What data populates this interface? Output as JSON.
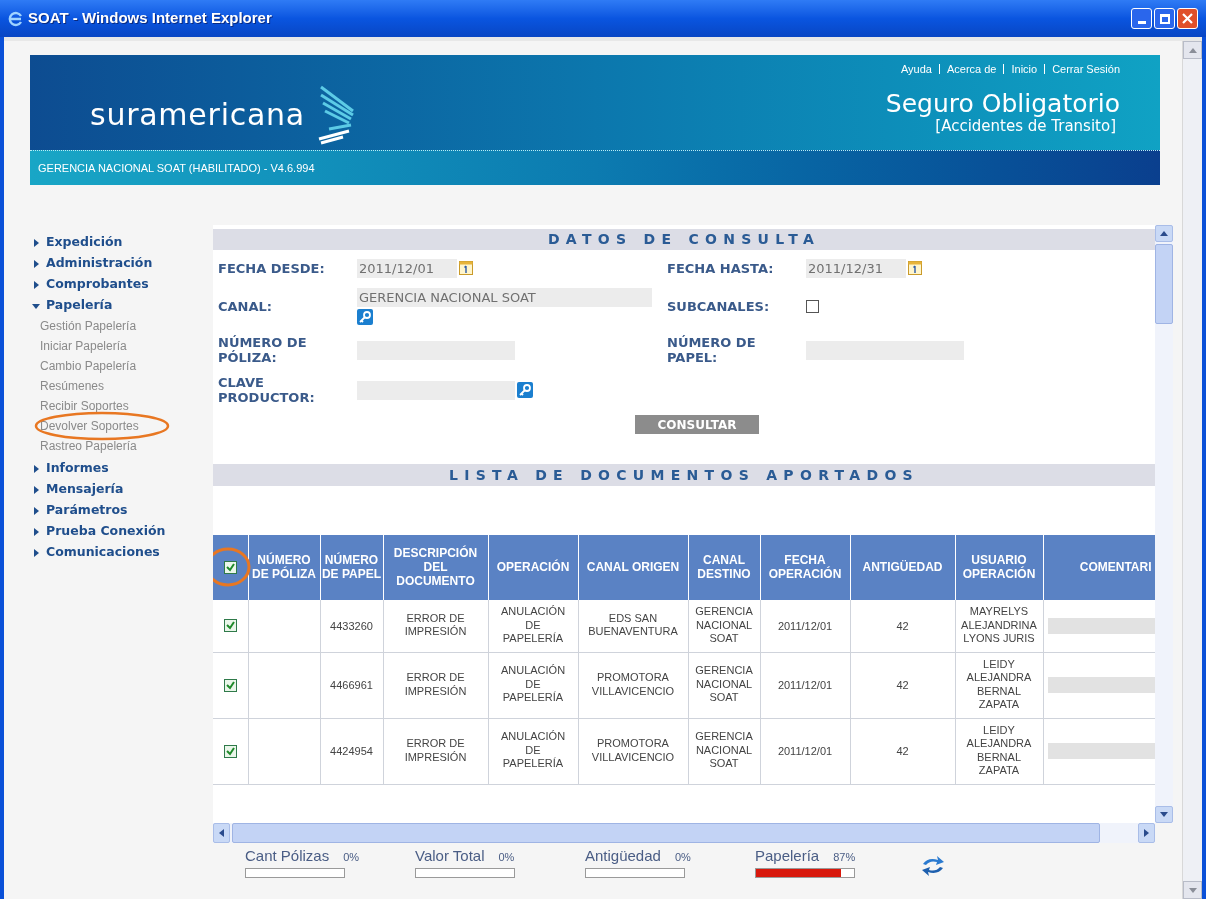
{
  "window": {
    "title": "SOAT - Windows Internet Explorer"
  },
  "header": {
    "brand": "suramericana",
    "links": [
      "Ayuda",
      "Acerca de",
      "Inicio",
      "Cerrar Sesión"
    ],
    "title": "Seguro Obligatorio",
    "subtitle": "[Accidentes de Transito]",
    "status": "GERENCIA NACIONAL SOAT (HABILITADO) - V4.6.994"
  },
  "sidebar": {
    "items": [
      {
        "label": "Expedición",
        "expanded": false
      },
      {
        "label": "Administración",
        "expanded": false
      },
      {
        "label": "Comprobantes",
        "expanded": false
      },
      {
        "label": "Papelería",
        "expanded": true,
        "children": [
          {
            "label": "Gestión Papelería",
            "annotated": false
          },
          {
            "label": "Iniciar Papelería",
            "annotated": false
          },
          {
            "label": "Cambio Papelería",
            "annotated": false
          },
          {
            "label": "Resúmenes",
            "annotated": false
          },
          {
            "label": "Recibir Soportes",
            "annotated": false
          },
          {
            "label": "Devolver Soportes",
            "annotated": true
          },
          {
            "label": "Rastreo Papelería",
            "annotated": false
          }
        ]
      },
      {
        "label": "Informes",
        "expanded": false
      },
      {
        "label": "Mensajería",
        "expanded": false
      },
      {
        "label": "Parámetros",
        "expanded": false
      },
      {
        "label": "Prueba Conexión",
        "expanded": false
      },
      {
        "label": "Comunicaciones",
        "expanded": false
      }
    ]
  },
  "query": {
    "title": "DATOS DE CONSULTA",
    "fields": [
      {
        "label": "FECHA DESDE:",
        "kind": "date",
        "value": "2011/12/01"
      },
      {
        "label": "FECHA HASTA:",
        "kind": "date",
        "value": "2011/12/31"
      },
      {
        "label": "CANAL:",
        "kind": "lookup",
        "value": "GERENCIA NACIONAL SOAT"
      },
      {
        "label": "SUBCANALES:",
        "kind": "checkbox",
        "checked": false
      },
      {
        "label": "NÚMERO DE PÓLIZA:",
        "kind": "text"
      },
      {
        "label": "NÚMERO DE PAPEL:",
        "kind": "text"
      },
      {
        "label": "CLAVE PRODUCTOR:",
        "kind": "lookup_inline"
      }
    ],
    "button": "CONSULTAR"
  },
  "documents": {
    "title": "LISTA DE DOCUMENTOS APORTADOS",
    "select_all": {
      "checked": true,
      "annotated": true
    },
    "columns": [
      "NÚMERO DE PÓLIZA",
      "NÚMERO DE PAPEL",
      "DESCRIPCIÓN DEL DOCUMENTO",
      "OPERACIÓN",
      "CANAL ORIGEN",
      "CANAL DESTINO",
      "FECHA OPERACIÓN",
      "ANTIGÜEDAD",
      "USUARIO OPERACIÓN",
      "COMENTARI"
    ],
    "rows": [
      {
        "checked": true,
        "papel": "4433260",
        "descripcion": "ERROR DE IMPRESIÓN",
        "operacion": "ANULACIÓN DE PAPELERÍA",
        "canal_origen": "EDS SAN BUENAVENTURA",
        "canal_destino": "GERENCIA NACIONAL SOAT",
        "fecha": "2011/12/01",
        "antiguedad": "42",
        "usuario": "MAYRELYS ALEJANDRINA LYONS JURIS"
      },
      {
        "checked": true,
        "papel": "4466961",
        "descripcion": "ERROR DE IMPRESIÓN",
        "operacion": "ANULACIÓN DE PAPELERÍA",
        "canal_origen": "PROMOTORA VILLAVICENCIO",
        "canal_destino": "GERENCIA NACIONAL SOAT",
        "fecha": "2011/12/01",
        "antiguedad": "42",
        "usuario": "LEIDY ALEJANDRA BERNAL ZAPATA"
      },
      {
        "checked": true,
        "papel": "4424954",
        "descripcion": "ERROR DE IMPRESIÓN",
        "operacion": "ANULACIÓN DE PAPELERÍA",
        "canal_origen": "PROMOTORA VILLAVICENCIO",
        "canal_destino": "GERENCIA NACIONAL SOAT",
        "fecha": "2011/12/01",
        "antiguedad": "42",
        "usuario": "LEIDY ALEJANDRA BERNAL ZAPATA"
      }
    ]
  },
  "indicators": [
    {
      "label": "Cant Pólizas",
      "reading": "0%",
      "level": 0
    },
    {
      "label": "Valor Total",
      "reading": "0%",
      "level": 0
    },
    {
      "label": "Antigüedad",
      "reading": "0%",
      "level": 0
    },
    {
      "label": "Papelería",
      "reading": "87%",
      "level": 0.87
    }
  ]
}
